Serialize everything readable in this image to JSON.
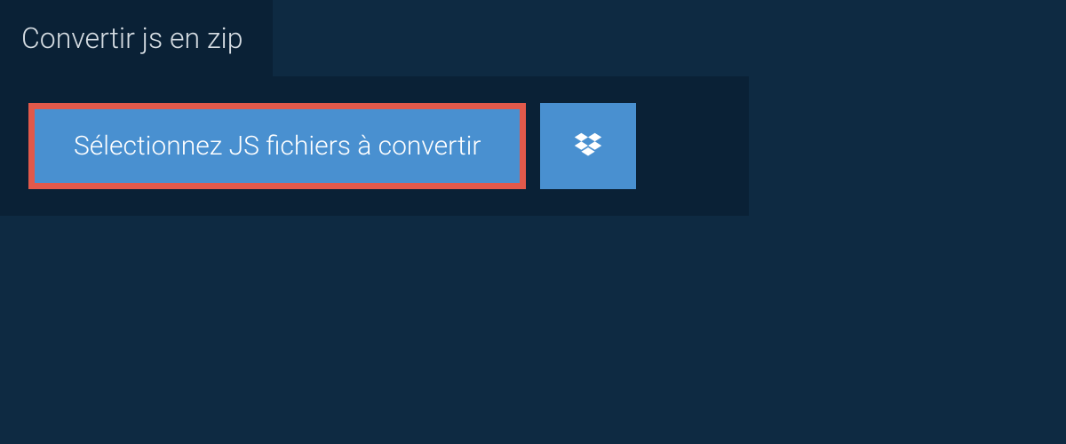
{
  "tab": {
    "title": "Convertir js en zip"
  },
  "actions": {
    "select_files_label": "Sélectionnez JS fichiers à convertir"
  },
  "colors": {
    "page_bg": "#0e2a42",
    "panel_bg": "#0a2136",
    "button_bg": "#4990d0",
    "highlight_border": "#e2594b",
    "text_light": "#d5dce2",
    "text_white": "#ffffff"
  }
}
